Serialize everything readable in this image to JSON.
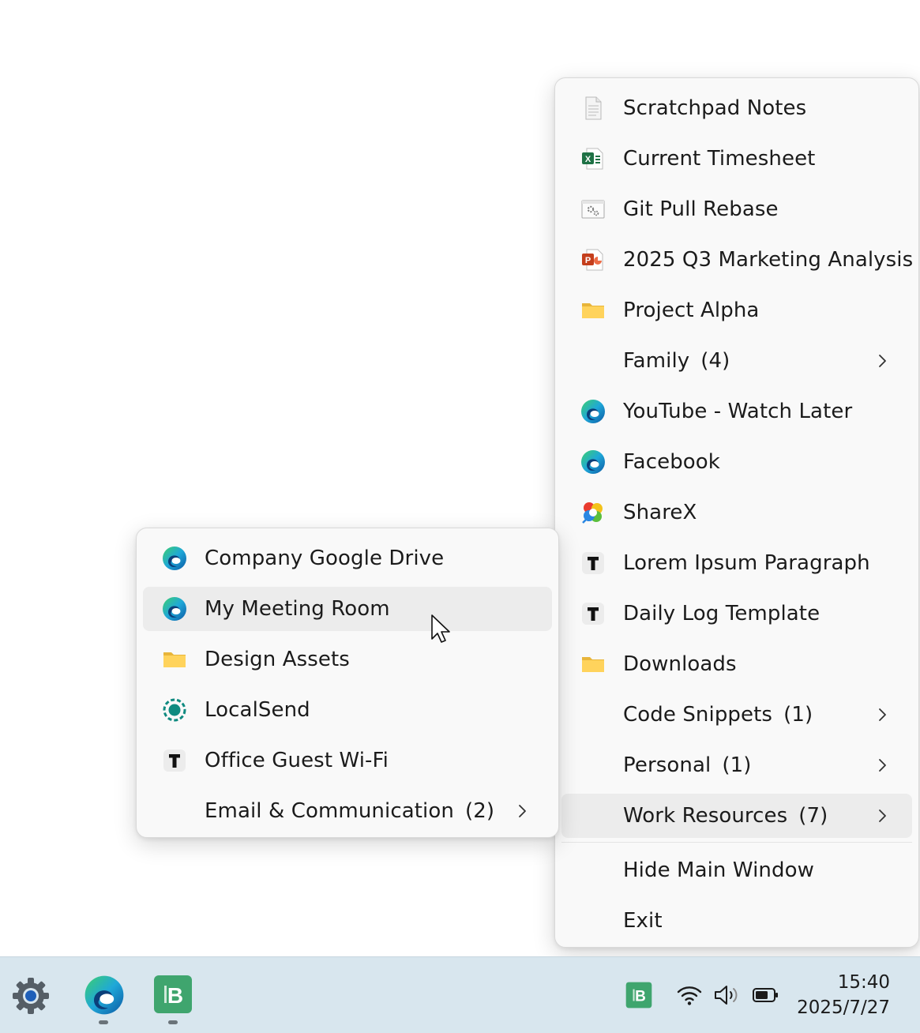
{
  "main_menu": {
    "items": [
      {
        "label": "Scratchpad Notes",
        "icon": "notepad-file-icon"
      },
      {
        "label": "Current Timesheet",
        "icon": "excel-file-icon"
      },
      {
        "label": "Git Pull Rebase",
        "icon": "script-file-icon"
      },
      {
        "label": "2025 Q3 Marketing Analysis",
        "icon": "powerpoint-file-icon"
      },
      {
        "label": "Project Alpha",
        "icon": "folder-icon"
      },
      {
        "label": "Family",
        "count": "(4)",
        "submenu": true
      },
      {
        "label": "YouTube - Watch Later",
        "icon": "edge-browser-icon"
      },
      {
        "label": "Facebook",
        "icon": "edge-browser-icon"
      },
      {
        "label": "ShareX",
        "icon": "sharex-icon"
      },
      {
        "label": "Lorem Ipsum Paragraph",
        "icon": "text-snippet-icon"
      },
      {
        "label": "Daily Log Template",
        "icon": "text-snippet-icon"
      },
      {
        "label": "Downloads",
        "icon": "folder-icon"
      },
      {
        "label": "Code Snippets",
        "count": "(1)",
        "submenu": true
      },
      {
        "label": "Personal",
        "count": "(1)",
        "submenu": true
      },
      {
        "label": "Work Resources",
        "count": "(7)",
        "submenu": true,
        "active": true
      }
    ],
    "footer": [
      {
        "label": "Hide Main Window"
      },
      {
        "label": "Exit"
      }
    ]
  },
  "sub_menu": {
    "items": [
      {
        "label": "Company Google Drive",
        "icon": "edge-browser-icon"
      },
      {
        "label": "My Meeting Room",
        "icon": "edge-browser-icon",
        "hovered": true
      },
      {
        "label": "Design Assets",
        "icon": "folder-icon"
      },
      {
        "label": "LocalSend",
        "icon": "localsend-icon"
      },
      {
        "label": "Office Guest Wi-Fi",
        "icon": "text-snippet-icon"
      },
      {
        "label": "Email & Communication",
        "count": "(2)",
        "submenu": true
      }
    ]
  },
  "taskbar": {
    "pinned": [
      "settings-gear-icon",
      "edge-browser-icon",
      "app-b-icon"
    ],
    "tray": [
      "app-b-tray-icon",
      "wifi-icon",
      "volume-icon",
      "battery-icon"
    ],
    "clock": {
      "time": "15:40",
      "date": "2025/7/27"
    }
  },
  "colors": {
    "menu_bg": "#f9f9f9",
    "hover_bg": "#ececec",
    "taskbar_bg": "#d8e6ee",
    "app_b_green": "#3fa56e"
  }
}
